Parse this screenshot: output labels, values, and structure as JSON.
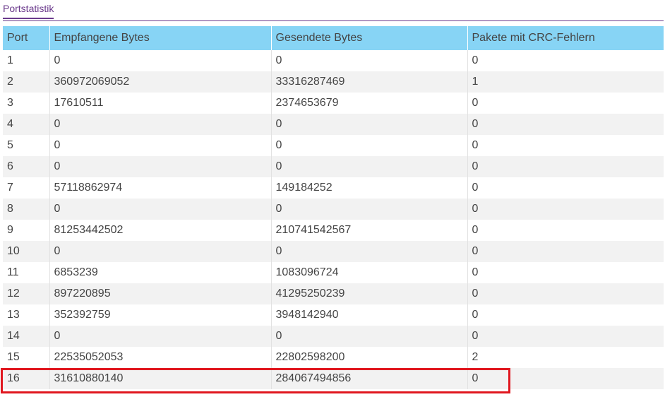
{
  "tab": {
    "label": "Portstatistik"
  },
  "table": {
    "headers": [
      "Port",
      "Empfangene Bytes",
      "Gesendete Bytes",
      "Pakete mit CRC-Fehlern"
    ],
    "rows": [
      [
        "1",
        "0",
        "0",
        "0"
      ],
      [
        "2",
        "360972069052",
        "33316287469",
        "1"
      ],
      [
        "3",
        "17610511",
        "2374653679",
        "0"
      ],
      [
        "4",
        "0",
        "0",
        "0"
      ],
      [
        "5",
        "0",
        "0",
        "0"
      ],
      [
        "6",
        "0",
        "0",
        "0"
      ],
      [
        "7",
        "57118862974",
        "149184252",
        "0"
      ],
      [
        "8",
        "0",
        "0",
        "0"
      ],
      [
        "9",
        "81253442502",
        "210741542567",
        "0"
      ],
      [
        "10",
        "0",
        "0",
        "0"
      ],
      [
        "11",
        "6853239",
        "1083096724",
        "0"
      ],
      [
        "12",
        "897220895",
        "41295250239",
        "0"
      ],
      [
        "13",
        "352392759",
        "3948142940",
        "0"
      ],
      [
        "14",
        "0",
        "0",
        "0"
      ],
      [
        "15",
        "22535052053",
        "22802598200",
        "2"
      ],
      [
        "16",
        "31610880140",
        "284067494856",
        "0"
      ]
    ]
  },
  "colors": {
    "tab_accent": "#6b3a8c",
    "header_bg": "#87d4f5",
    "highlight": "#e0171f"
  }
}
